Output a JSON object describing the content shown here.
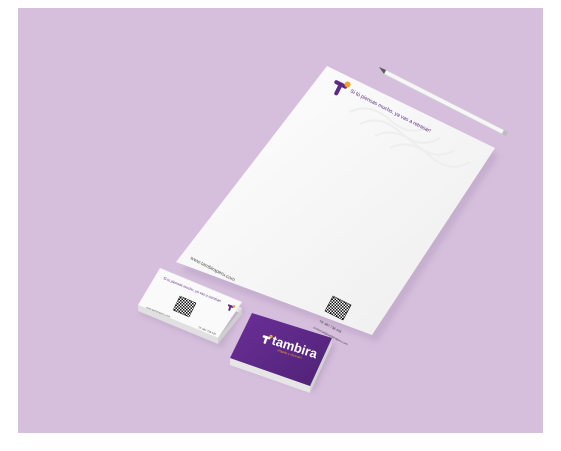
{
  "scene": {
    "background_color": "#d6bfdd",
    "frame_color": "#ffffff",
    "brand_purple": "#5c2a86",
    "brand_accent_orange": "#f4a22a"
  },
  "letterhead": {
    "tagline": "Si tú piensas mucho, ya vas a retrasar!",
    "website": "www.tambiraperu.com",
    "contact_line_1": "Tlf: 987 738 405",
    "contact_line_2": "comercial@tambiraperu.com"
  },
  "business_card_back": {
    "tagline": "Si tú piensas mucho, ya vas a retrasar!",
    "footer_left": "www.tambiraperu.com",
    "footer_right": "Tlf: 987 738 405"
  },
  "business_card_front": {
    "logo_text": "tambira",
    "slogan": "¡Rápido y eficiente!"
  }
}
